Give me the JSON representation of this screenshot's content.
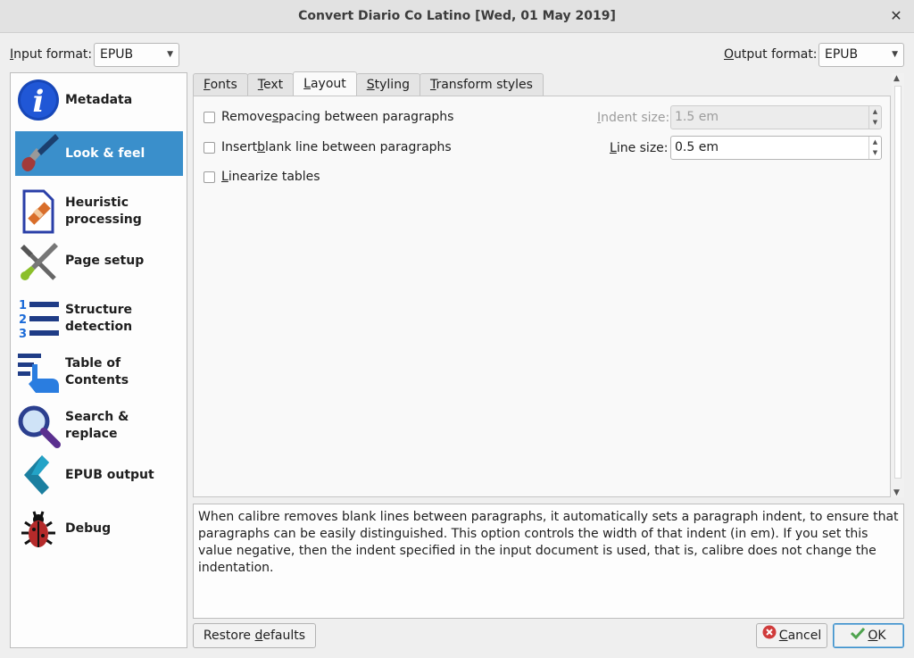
{
  "window": {
    "title": "Convert Diario Co Latino [Wed, 01 May 2019]",
    "close_glyph": "✕"
  },
  "input_format": {
    "label_mnemonic": "I",
    "label_rest": "nput format:",
    "value": "EPUB"
  },
  "output_format": {
    "label_mnemonic": "O",
    "label_rest": "utput format:",
    "value": "EPUB"
  },
  "sidebar": {
    "items": [
      {
        "label": "Metadata",
        "icon": "metadata-icon"
      },
      {
        "label": "Look & feel",
        "icon": "brush-icon",
        "active": true
      },
      {
        "label": "Heuristic processing",
        "icon": "heuristic-icon"
      },
      {
        "label": "Page setup",
        "icon": "tools-icon"
      },
      {
        "label": "Structure detection",
        "icon": "numbered-list-icon"
      },
      {
        "label": "Table of Contents",
        "icon": "toc-icon"
      },
      {
        "label": "Search & replace",
        "icon": "magnifier-icon"
      },
      {
        "label": "EPUB output",
        "icon": "epub-icon"
      },
      {
        "label": "Debug",
        "icon": "bug-icon"
      }
    ]
  },
  "tabs": [
    {
      "mnemonic": "F",
      "rest": "onts"
    },
    {
      "mnemonic": "T",
      "rest": "ext"
    },
    {
      "mnemonic": "L",
      "rest": "ayout",
      "active": true
    },
    {
      "mnemonic": "S",
      "rest": "tyling"
    },
    {
      "mnemonic": "T",
      "rest": "ransform styles"
    }
  ],
  "layout": {
    "remove_spacing": {
      "pre": "Remove ",
      "mnemonic": "s",
      "post": "pacing between paragraphs",
      "checked": false
    },
    "insert_blank": {
      "pre": "Insert ",
      "mnemonic": "b",
      "post": "lank line between paragraphs",
      "checked": false
    },
    "linearize": {
      "pre": "",
      "mnemonic": "L",
      "post": "inearize tables",
      "checked": false
    },
    "indent_size": {
      "label_mnemonic": "I",
      "label_rest": "ndent size:",
      "value": "1.5 em",
      "enabled": false
    },
    "line_size": {
      "label_mnemonic": "L",
      "label_rest": "ine size:",
      "value": "0.5 em",
      "enabled": true
    }
  },
  "help_text": "When calibre removes blank lines between paragraphs, it automatically sets a paragraph indent, to ensure that paragraphs can be easily distinguished. This option controls the width of that indent (in em). If you set this value negative, then the indent specified in the input document is used, that is, calibre does not change the indentation.",
  "buttons": {
    "restore": {
      "pre": "Restore ",
      "mnemonic": "d",
      "post": "efaults"
    },
    "cancel": {
      "mnemonic": "C",
      "post": "ancel"
    },
    "ok": {
      "mnemonic": "O",
      "post": "K"
    }
  },
  "colors": {
    "accent": "#3a8fcb",
    "cancel_icon": "#d03b3b",
    "ok_check": "#4ea34e"
  }
}
